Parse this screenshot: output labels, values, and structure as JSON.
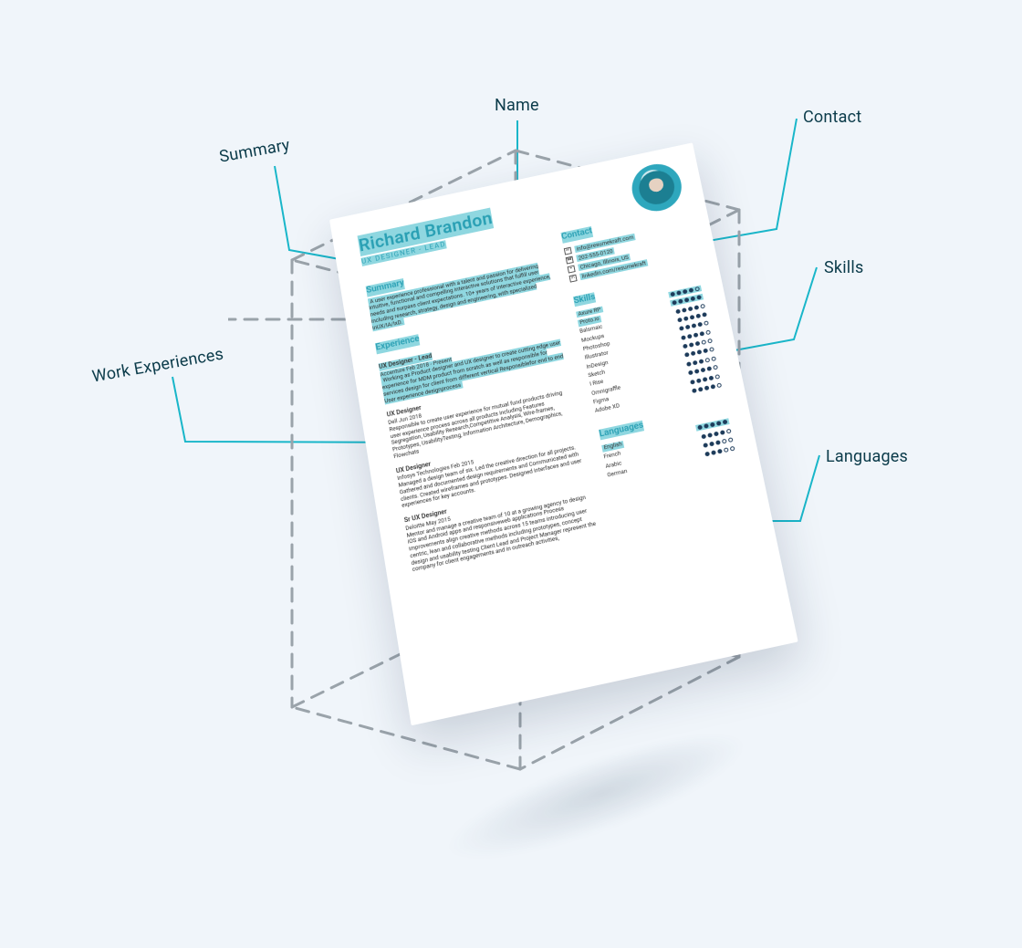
{
  "callouts": {
    "name": "Name",
    "summary": "Summary",
    "contact": "Contact",
    "skills": "Skills",
    "work_experiences": "Work Experiences",
    "languages": "Languages"
  },
  "resume": {
    "name": "Richard Brandon",
    "role": "UX DESIGNER - LEAD",
    "summary_heading": "Summary",
    "summary": "A user experience professional with a talent and passion for delivering intuitive, functional and compelling interactive solutions that fulfill user needs and surpass client expectations. 10+ years of interactive experience, including research, strategy, design and engineering, with specialized inUX/IA/IxD.",
    "experience_heading": "Experience",
    "jobs": [
      {
        "title": "UX Designer - Lead",
        "company_line": "Accenture  Feb 2018 - Present",
        "body": "Working as Product designer and UX designer to create cutting edge user experience for MDM product from scratch as well as responsible for services design for client from different vertical Responsiblefor end to end User experience designprocess"
      },
      {
        "title": "UX Designer",
        "company_line": "Dell  Jun 2018",
        "body": "Responsible to create user experience for mutual fund products driving user experience process across all products including Features Segregation, Usability Research,Competitive Analysis, Wire-frames, Prototypes, UsabilityTesting, Information Architecture, Demographics, Flowchats"
      },
      {
        "title": "UX Designer",
        "company_line": "Infosys Technologies  Feb 2015",
        "body": "Managed a design team of six. Led the creative direction for all projects. Gathered and documented design requirements and Communicated with clients. Created wireframes and prototypes. Designed interfaces and user experiences for key accounts."
      },
      {
        "title": "Sr UX Designer",
        "company_line": "Deloitte  May 2015",
        "body": "Mentor and manage a creative team of 10 at a growing agency to design iOS and Android apps and responsiveweb applications Process improvements align creative methods across 15 teams introducing user centric, lean and collaborative methods including prototypes, concept design and usability testing Client Lead and Project Manager represent the company for client engagements and in outreach activities,"
      }
    ],
    "contact_heading": "Contact",
    "contact": {
      "email": "info@resumekraft.com",
      "phone": "202-555-0120",
      "location": "Chicago, Illinois, US",
      "linkedin": "linkedin.com/resumekraft"
    },
    "skills_heading": "Skills",
    "skills": [
      {
        "name": "Axure RP",
        "rating": 4,
        "highlight": true
      },
      {
        "name": "Proto.io",
        "rating": 5,
        "highlight": true
      },
      {
        "name": "Balsmaic",
        "rating": 4
      },
      {
        "name": "Mockups",
        "rating": 5
      },
      {
        "name": "Photoshop",
        "rating": 4
      },
      {
        "name": "Illustrator",
        "rating": 4
      },
      {
        "name": "InDesign",
        "rating": 3
      },
      {
        "name": "Sketch",
        "rating": 4
      },
      {
        "name": "I Rise",
        "rating": 3
      },
      {
        "name": "Omnigraffle",
        "rating": 4
      },
      {
        "name": "Figma",
        "rating": 4
      },
      {
        "name": "Adobe XD",
        "rating": 4
      }
    ],
    "languages_heading": "Languages",
    "languages": [
      {
        "name": "English",
        "rating": 5,
        "highlight": true
      },
      {
        "name": "French",
        "rating": 4
      },
      {
        "name": "Arabic",
        "rating": 3
      },
      {
        "name": "German",
        "rating": 3
      }
    ]
  }
}
